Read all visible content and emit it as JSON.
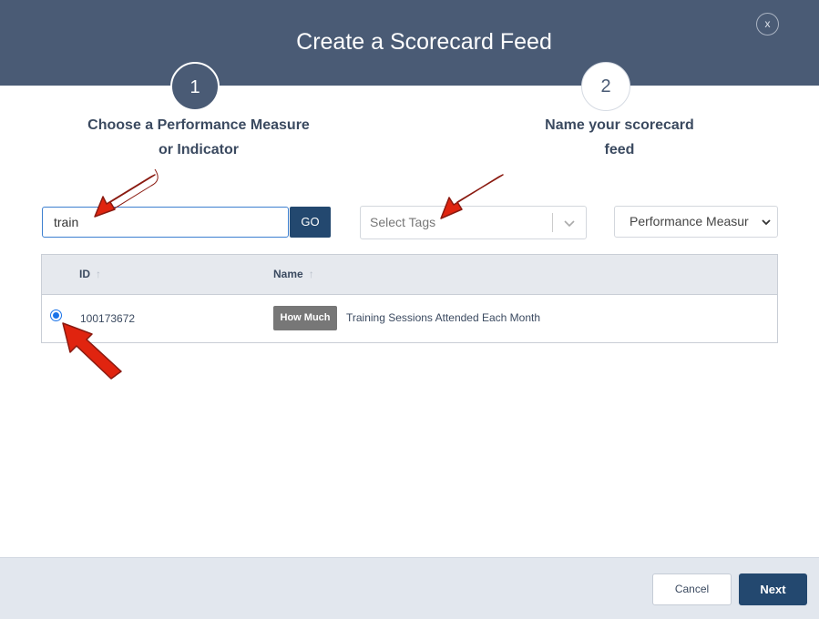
{
  "dialog": {
    "title": "Create a Scorecard Feed",
    "close_label": "x"
  },
  "steps": [
    {
      "number": "1",
      "label_line1": "Choose a Performance Measure",
      "label_line2": "or Indicator"
    },
    {
      "number": "2",
      "label_line1": "Name your scorecard",
      "label_line2": "feed"
    }
  ],
  "search": {
    "value": "train",
    "go_label": "GO"
  },
  "tags": {
    "placeholder": "Select Tags"
  },
  "type_filter": {
    "selected": "Performance Measur"
  },
  "table": {
    "columns": [
      {
        "label": "ID",
        "sort": "↑"
      },
      {
        "label": "Name",
        "sort": "↑"
      }
    ],
    "rows": [
      {
        "selected": true,
        "id": "100173672",
        "badge": "How Much",
        "name": "Training Sessions Attended Each Month"
      }
    ]
  },
  "footer": {
    "cancel_label": "Cancel",
    "next_label": "Next"
  },
  "colors": {
    "header": "#4a5b75",
    "primary_button": "#23486f",
    "annotation_arrow": "#e0240f"
  },
  "annotations": [
    "arrow",
    "arrow",
    "arrow"
  ]
}
